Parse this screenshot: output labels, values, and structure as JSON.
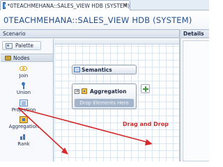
{
  "editor_tab": {
    "title": "*0TEACHMEHANA::SALES_VIEW HDB (SYSTEM)",
    "close_glyph": "✕"
  },
  "view_title": "0TEACHMEHANA::SALES_VIEW HDB (SYSTEM)",
  "scenario": {
    "label": "Scenario",
    "palette_label": "Palette",
    "nodes_label": "Nodes",
    "nodes": [
      {
        "label": "Join",
        "icon": "join-icon"
      },
      {
        "label": "Union",
        "icon": "union-icon"
      },
      {
        "label": "Projection",
        "icon": "projection-icon"
      },
      {
        "label": "Aggregation",
        "icon": "aggregation-icon"
      },
      {
        "label": "Rank",
        "icon": "rank-icon"
      }
    ]
  },
  "canvas": {
    "semantics_label": "Semantics",
    "aggregation_label": "Aggregation",
    "drop_zone_label": "Drop Elements Here",
    "annotation_label": "Drag and Drop",
    "annotation_color": "#d42a2a"
  },
  "details": {
    "label": "Details"
  }
}
